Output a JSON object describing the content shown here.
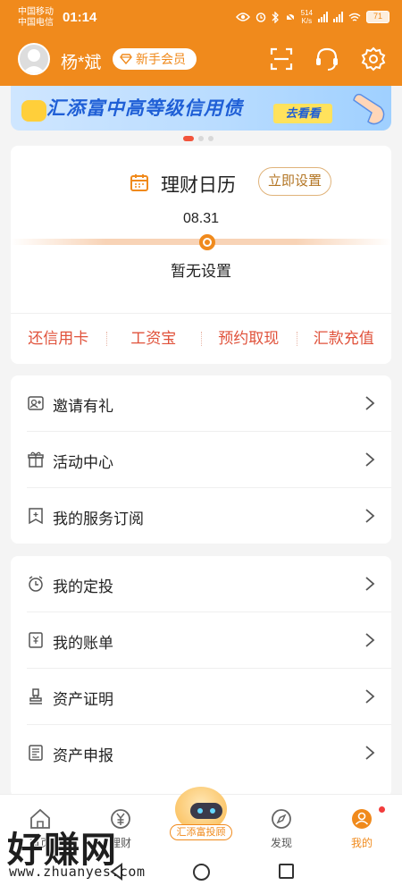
{
  "status_bar": {
    "carrier_1": "中国移动",
    "carrier_2": "中国电信",
    "time": "01:14",
    "net_speed": "514\nK/s",
    "battery": "71"
  },
  "header": {
    "user_name": "杨*斌",
    "member_badge": "新手会员",
    "icons": [
      "scan-icon",
      "customer-service-icon",
      "settings-icon"
    ],
    "accent_color": "#f08a1c"
  },
  "banner": {
    "text": "汇添富中高等级信用债",
    "cta": "去看看",
    "pager_count": 3,
    "pager_active": 0
  },
  "calendar": {
    "title": "理财日历",
    "set_button": "立即设置",
    "date": "08.31",
    "empty_text": "暂无设置"
  },
  "quick_links": [
    "还信用卡",
    "工资宝",
    "预约取现",
    "汇款充值"
  ],
  "menu_group_1": [
    {
      "label": "邀请有礼",
      "icon": "invite-icon"
    },
    {
      "label": "活动中心",
      "icon": "gift-icon"
    },
    {
      "label": "我的服务订阅",
      "icon": "subscription-icon"
    }
  ],
  "menu_group_2": [
    {
      "label": "我的定投",
      "icon": "alarm-clock-icon"
    },
    {
      "label": "我的账单",
      "icon": "bill-icon"
    },
    {
      "label": "资产证明",
      "icon": "stamp-icon"
    },
    {
      "label": "资产申报",
      "icon": "declaration-icon"
    }
  ],
  "tabbar": {
    "tab_1": "首页",
    "tab_2": "理财",
    "center_label": "汇添富投顾",
    "tab_4": "发现",
    "tab_5": "我的",
    "active_tab": "我的"
  },
  "watermark": {
    "title": "好赚网",
    "url": "www.zhuanyes.com"
  }
}
